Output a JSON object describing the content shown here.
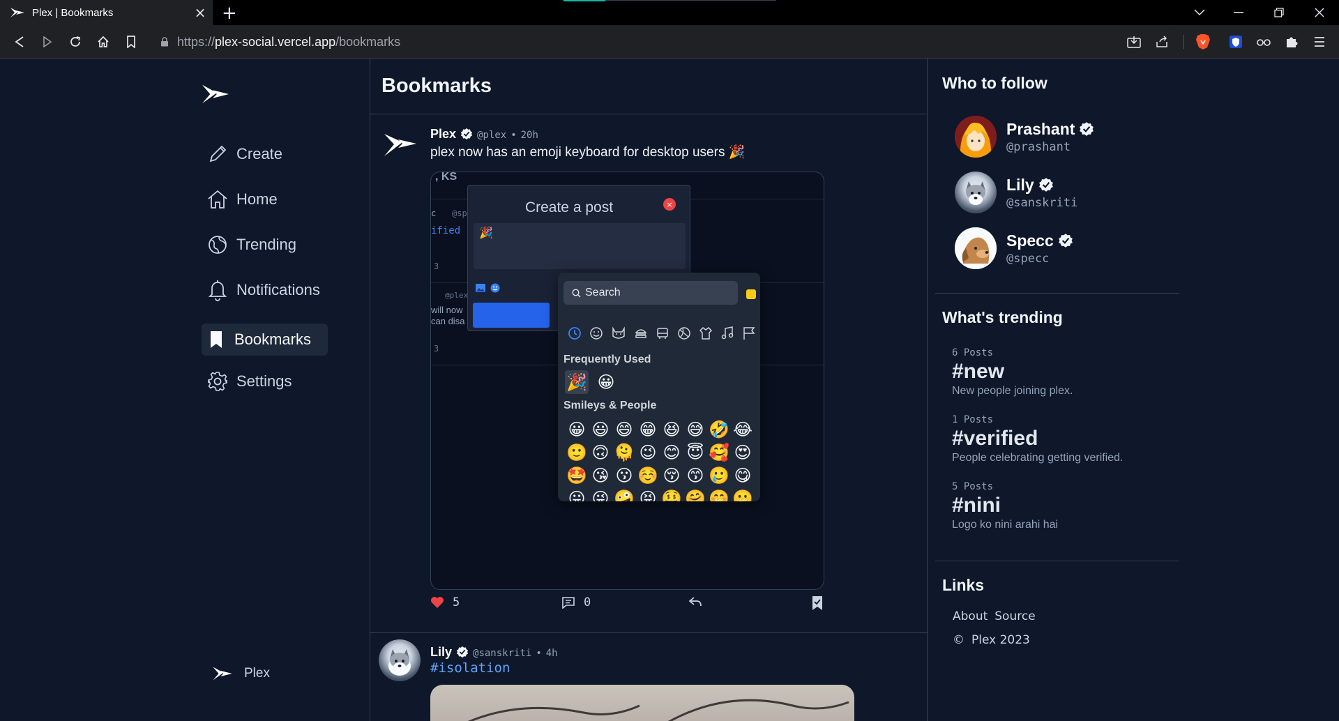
{
  "browser": {
    "tab_title": "Plex | Bookmarks",
    "tab_close": "×",
    "new_tab": "+",
    "url_prefix": "https://",
    "url_host": "plex-social.vercel.app",
    "url_path": "/bookmarks"
  },
  "sidebar": {
    "nav": [
      {
        "label": "Create",
        "icon": "pencil-icon"
      },
      {
        "label": "Home",
        "icon": "home-icon"
      },
      {
        "label": "Trending",
        "icon": "globe-icon"
      },
      {
        "label": "Notifications",
        "icon": "bell-icon"
      },
      {
        "label": "Bookmarks",
        "icon": "bookmark-icon",
        "active": true
      },
      {
        "label": "Settings",
        "icon": "gear-icon"
      }
    ],
    "footer_label": "Plex"
  },
  "feed": {
    "title": "Bookmarks",
    "posts": [
      {
        "name": "Plex",
        "handle": "@plex",
        "separator": "•",
        "time": "20h",
        "text": "plex now has an emoji keyboard for desktop users 🎉",
        "likes": "5",
        "comments": "0",
        "screenshot": {
          "faded_header": ", KS",
          "faded_lines": [
            "c",
            "@sp",
            "ified",
            "3",
            "@plex",
            "will now",
            "can disa",
            "3"
          ],
          "modal_title": "Create a post",
          "modal_close": "×",
          "modal_text": "🎉",
          "picker": {
            "search_placeholder": "Search",
            "frequent_title": "Frequently Used",
            "frequent": [
              "🎉",
              "😀"
            ],
            "smileys_title": "Smileys & People",
            "rows": [
              [
                "😀",
                "😃",
                "😄",
                "😁",
                "😆",
                "😅",
                "🤣",
                "😂"
              ],
              [
                "🙂",
                "🙃",
                "🫠",
                "😉",
                "😊",
                "😇",
                "🥰",
                "😍"
              ],
              [
                "🤩",
                "😘",
                "😗",
                "☺️",
                "😚",
                "😙",
                "🥲",
                "😋"
              ],
              [
                "😛",
                "😜",
                "🤪",
                "😝",
                "🤑",
                "🤗",
                "🤭",
                "🫢"
              ]
            ]
          }
        }
      },
      {
        "name": "Lily",
        "handle": "@sanskriti",
        "separator": "•",
        "time": "4h",
        "text": "#isolation"
      }
    ]
  },
  "right": {
    "follow_title": "Who to follow",
    "follow": [
      {
        "name": "Prashant",
        "handle": "@prashant"
      },
      {
        "name": "Lily",
        "handle": "@sanskriti"
      },
      {
        "name": "Specc",
        "handle": "@specc"
      }
    ],
    "trending_title": "What's trending",
    "trending": [
      {
        "count": "6 Posts",
        "tag": "#new",
        "desc": "New people joining plex."
      },
      {
        "count": "1 Posts",
        "tag": "#verified",
        "desc": "People celebrating getting verified."
      },
      {
        "count": "5 Posts",
        "tag": "#nini",
        "desc": "Logo ko nini arahi hai"
      }
    ],
    "links_title": "Links",
    "links": [
      "About",
      "Source"
    ],
    "copyright_symbol": "©",
    "copyright": "Plex 2023"
  },
  "colors": {
    "page_bg": "#0f172a",
    "accent": "#2563eb",
    "like": "#ef4444",
    "hashtag": "#60a5fa"
  }
}
